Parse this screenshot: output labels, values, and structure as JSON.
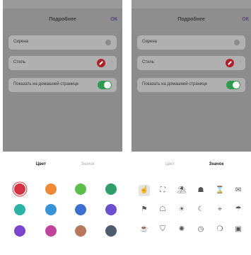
{
  "left_screen": {
    "title": "Подробнее",
    "ok_label": "ОК",
    "name_row": "Сирена",
    "style_row": "Стиль",
    "home_row": "Показать на домашней странице",
    "tabs": {
      "color": "Цвет",
      "icon": "Значок"
    },
    "active_tab": "color",
    "colors": [
      "#d63442",
      "#ee8a35",
      "#5cbf4a",
      "#2e9e6a",
      "#2bb3a3",
      "#3a92d8",
      "#3d6fd0",
      "#6b4fd1",
      "#7d44d0",
      "#c0459e",
      "#b9785a",
      "#4f5b6e"
    ],
    "selected_color_index": 0
  },
  "right_screen": {
    "title": "Подробнее",
    "ok_label": "ОК",
    "name_row": "Сирена",
    "style_row": "Стиль",
    "home_row": "Показать на домашней странице",
    "tabs": {
      "color": "Цвет",
      "icon": "Значок"
    },
    "active_tab": "icon",
    "icons": [
      {
        "name": "hand-icon",
        "glyph": "☝"
      },
      {
        "name": "gym-icon",
        "glyph": "⛶"
      },
      {
        "name": "beach-icon",
        "glyph": "⛱"
      },
      {
        "name": "run-icon",
        "glyph": "☗"
      },
      {
        "name": "hourglass-icon",
        "glyph": "⌛"
      },
      {
        "name": "mail-icon",
        "glyph": "✉"
      },
      {
        "name": "tag-icon",
        "glyph": "⚑"
      },
      {
        "name": "walk-icon",
        "glyph": "☖"
      },
      {
        "name": "sun-icon",
        "glyph": "☀"
      },
      {
        "name": "moon-icon",
        "glyph": "☾"
      },
      {
        "name": "location-icon",
        "glyph": "⌖"
      },
      {
        "name": "rain-icon",
        "glyph": "☂"
      },
      {
        "name": "cup-icon",
        "glyph": "☕"
      },
      {
        "name": "shield-icon",
        "glyph": "⛉"
      },
      {
        "name": "brightness-icon",
        "glyph": "✺"
      },
      {
        "name": "timer-icon",
        "glyph": "◷"
      },
      {
        "name": "drop-icon",
        "glyph": "❍"
      },
      {
        "name": "briefcase-icon",
        "glyph": "▣"
      }
    ],
    "selected_icon_index": 0
  }
}
